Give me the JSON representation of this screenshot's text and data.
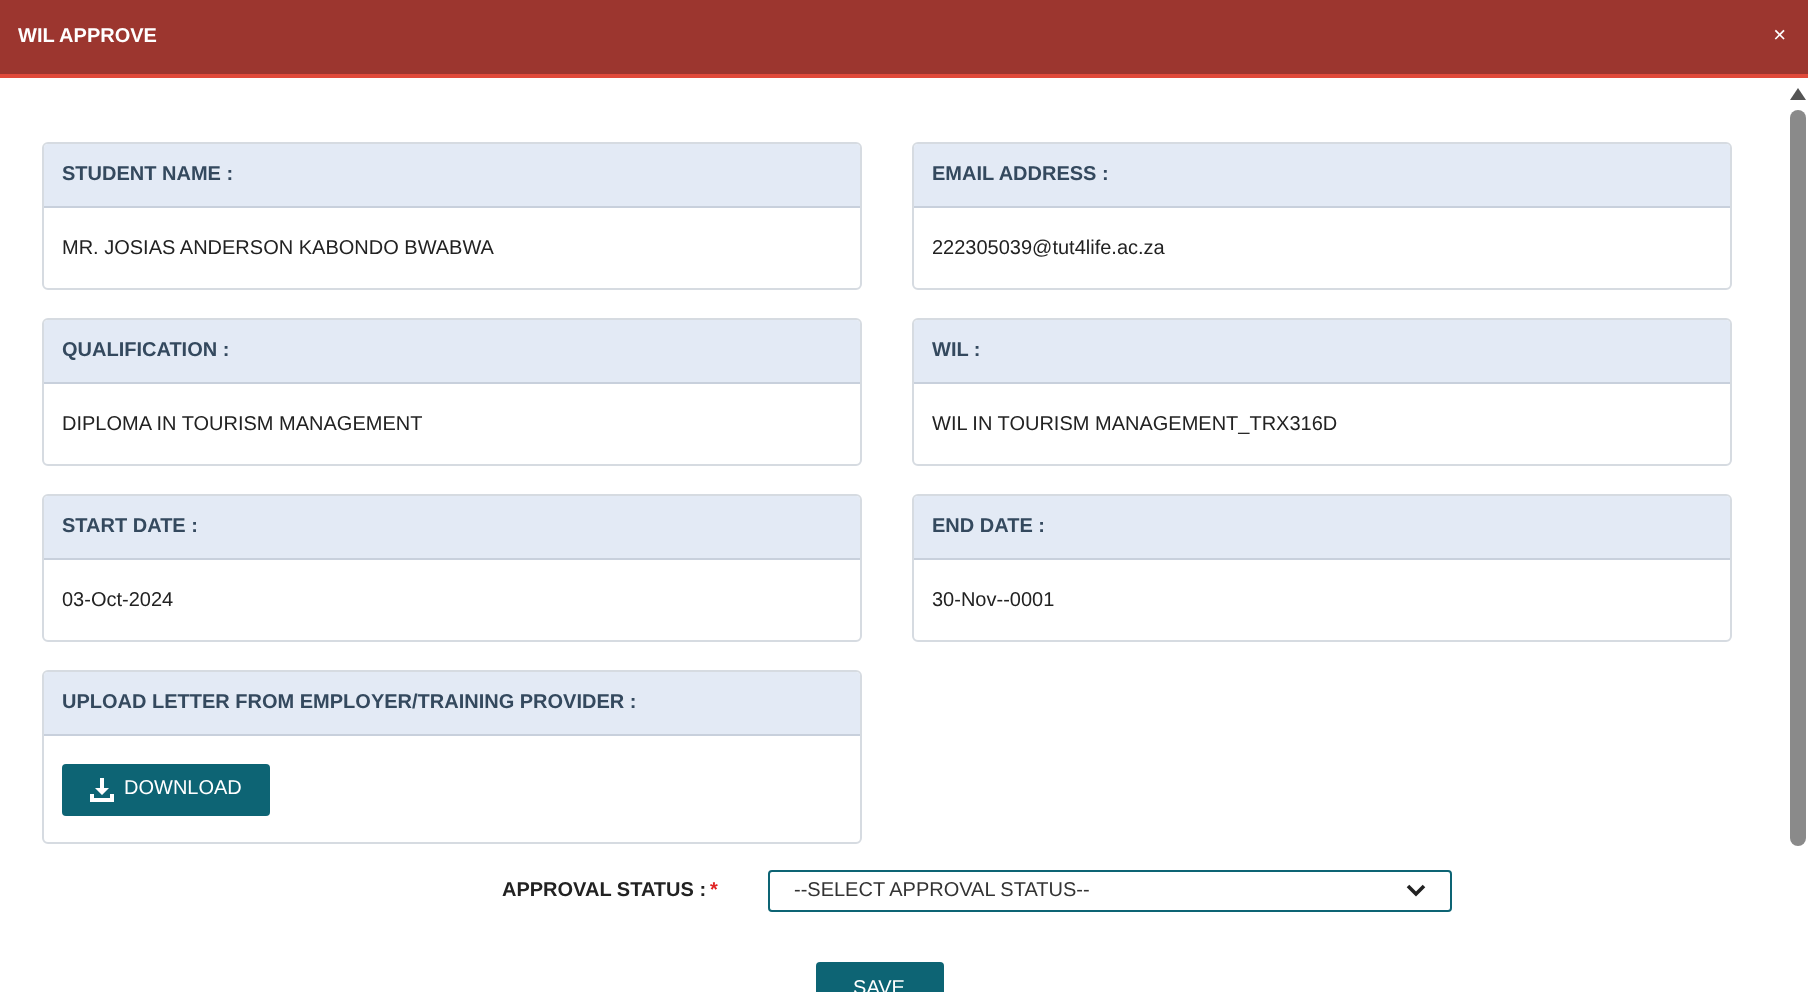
{
  "dialog": {
    "title": "WIL APPROVE",
    "close": "×"
  },
  "fields": [
    {
      "label": "STUDENT NAME :",
      "value": "MR. JOSIAS ANDERSON KABONDO BWABWA"
    },
    {
      "label": "EMAIL ADDRESS :",
      "value": "222305039@tut4life.ac.za"
    },
    {
      "label": "QUALIFICATION :",
      "value": "DIPLOMA IN TOURISM MANAGEMENT"
    },
    {
      "label": "WIL :",
      "value": "WIL IN TOURISM MANAGEMENT_TRX316D"
    },
    {
      "label": "START DATE :",
      "value": "03-Oct-2024"
    },
    {
      "label": "END DATE :",
      "value": "30-Nov--0001"
    }
  ],
  "upload": {
    "label": "UPLOAD LETTER FROM EMPLOYER/TRAINING PROVIDER :",
    "button": "DOWNLOAD"
  },
  "approval_status": {
    "label": "APPROVAL STATUS :",
    "required_mark": "*",
    "value": "--SELECT APPROVAL STATUS--"
  },
  "save_button": "SAVE"
}
